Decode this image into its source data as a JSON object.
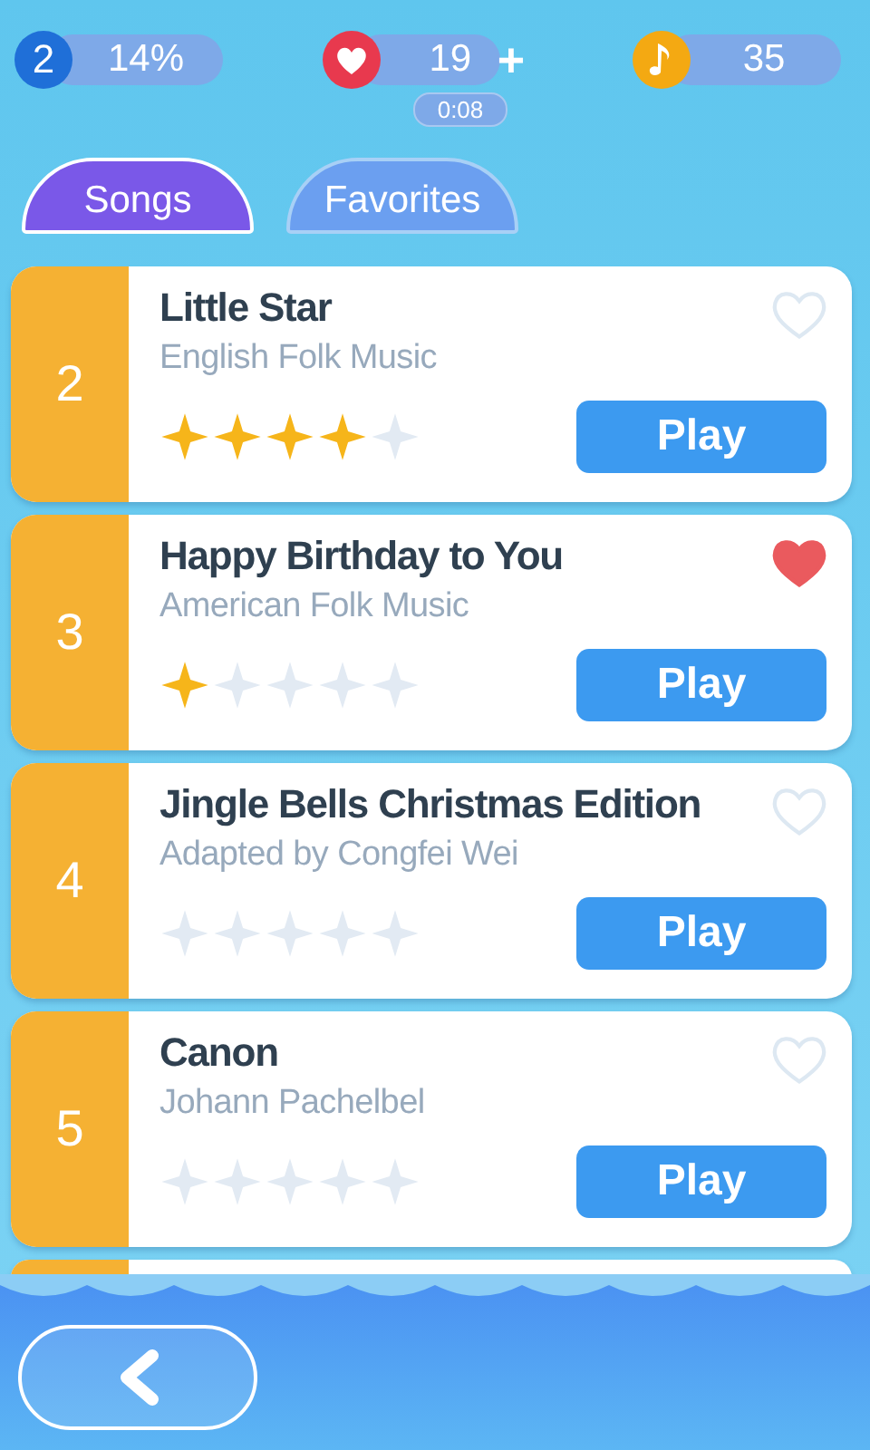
{
  "header": {
    "level": "2",
    "progress": "14%",
    "lives": "19",
    "add": "+",
    "timer": "0:08",
    "notes": "35"
  },
  "tabs": [
    {
      "label": "Songs",
      "selected": true
    },
    {
      "label": "Favorites",
      "selected": false
    }
  ],
  "songs": [
    {
      "number": "2",
      "title": "Little Star",
      "artist": "English Folk Music",
      "stars": 4,
      "favorite": false,
      "button": "Play"
    },
    {
      "number": "3",
      "title": "Happy Birthday to You",
      "artist": "American Folk Music",
      "stars": 1,
      "favorite": true,
      "button": "Play"
    },
    {
      "number": "4",
      "title": "Jingle Bells Christmas Edition",
      "artist": "Adapted by Congfei Wei",
      "stars": 0,
      "favorite": false,
      "button": "Play"
    },
    {
      "number": "5",
      "title": "Canon",
      "artist": "Johann Pachelbel",
      "stars": 0,
      "favorite": false,
      "button": "Play"
    }
  ]
}
